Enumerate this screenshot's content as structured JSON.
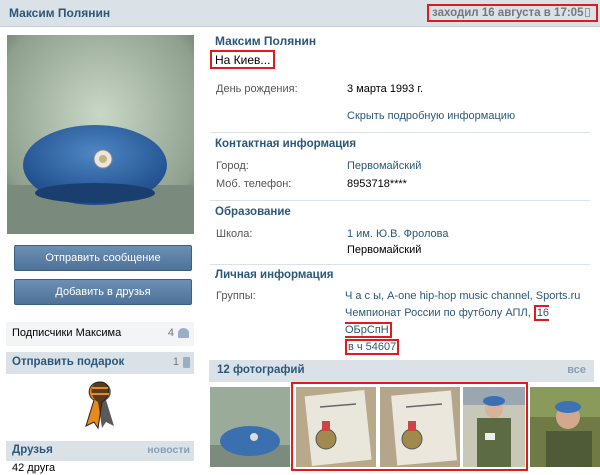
{
  "header": {
    "name": "Максим Полянин",
    "last_seen": "заходил 16 августа в 17:05"
  },
  "left": {
    "send_message": "Отправить сообщение",
    "add_friend": "Добавить в друзья",
    "subscribers_label": "Подписчики Максима",
    "subscribers_count": "4",
    "gift_label": "Отправить подарок",
    "gift_count": "1",
    "friends_label": "Друзья",
    "friends_news": "новости",
    "friends_count": "42 друга"
  },
  "profile": {
    "name": "Максим Полянин",
    "status": "На Киев...",
    "birthday_label": "День рождения:",
    "birthday_value": "3 марта 1993 г.",
    "hide_details": "Скрыть подробную информацию",
    "contact_header": "Контактная информация",
    "city_label": "Город:",
    "city_value": "Первомайский",
    "phone_label": "Моб. телефон:",
    "phone_value": "8953718****",
    "education_header": "Образование",
    "school_label": "Школа:",
    "school_value": "1 им. Ю.В. Фролова",
    "school_city": "Первомайский",
    "personal_header": "Личная информация",
    "groups_label": "Группы:",
    "groups": [
      "Ч а с ы",
      "A-one hip-hop music channel",
      "Sports.ru",
      "Чемпионат России по футболу АПЛ",
      "16 ОБрСпН в ч 54607"
    ],
    "groups_sep": ", ",
    "groups_hl_part1": "16 ОБрСпН",
    "groups_hl_part2": "в ч 54607"
  },
  "photos": {
    "header": "12 фотографий",
    "all": "все"
  },
  "colors": {
    "link": "#2b587a",
    "header_bg": "#dae2e8",
    "highlight": "#e01b1b",
    "button": "#5b7fa6"
  }
}
